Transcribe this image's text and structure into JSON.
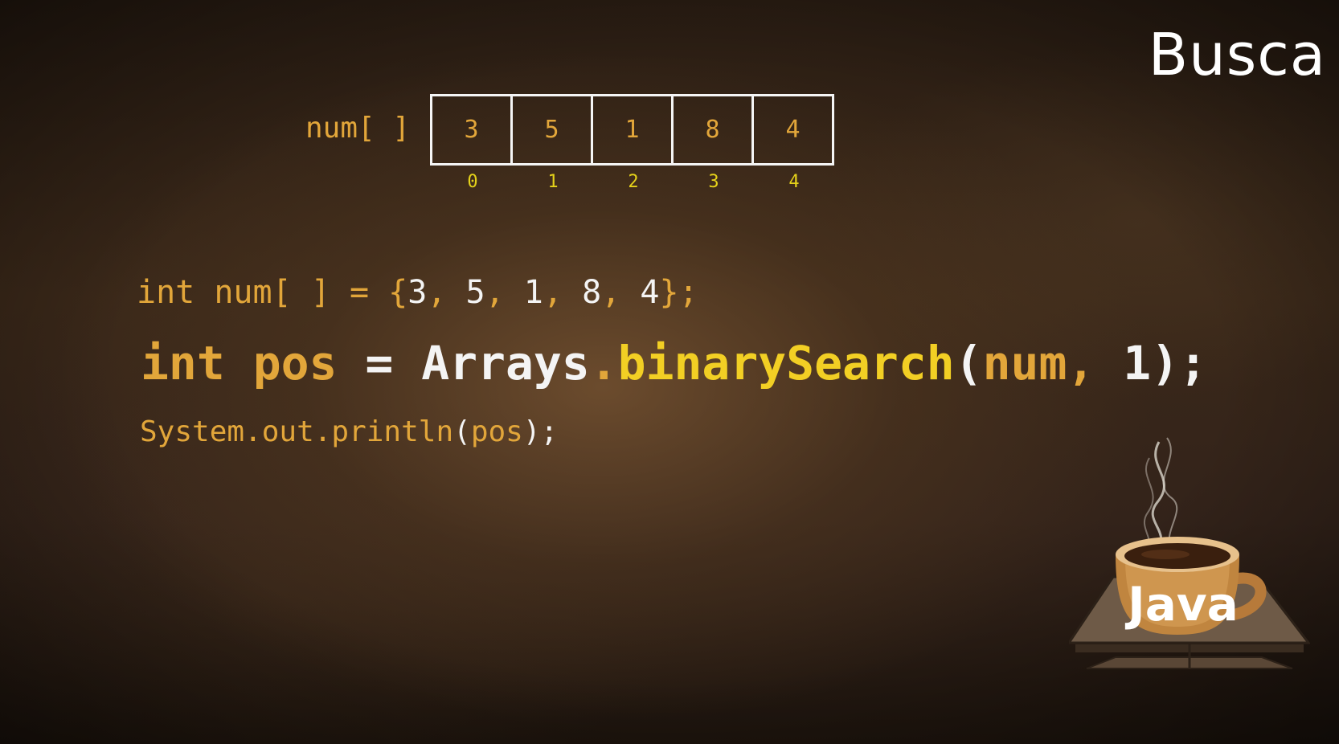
{
  "title": "Busca",
  "array": {
    "label": "num[ ]",
    "values": [
      "3",
      "5",
      "1",
      "8",
      "4"
    ],
    "indices": [
      "0",
      "1",
      "2",
      "3",
      "4"
    ]
  },
  "code": {
    "line1": {
      "int": "int",
      "name": "num[ ]",
      "eq": "=",
      "open": "{",
      "v0": "3",
      "c0": ",",
      "v1": "5",
      "c1": ",",
      "v2": "1",
      "c2": ",",
      "v3": "8",
      "c3": ",",
      "v4": "4",
      "close": "};"
    },
    "line2": {
      "int": "int",
      "name": "pos",
      "eq": "=",
      "cls": "Arrays",
      "dot": ".",
      "method": "binarySearch",
      "open": "(",
      "arg1": "num",
      "comma": ",",
      "arg2": "1",
      "close": ");"
    },
    "line3": {
      "call": "System.out.println",
      "open": "(",
      "arg": "pos",
      "close": ");"
    }
  },
  "logo": {
    "text": "Java",
    "icon": "coffee-cup-book-icon"
  }
}
